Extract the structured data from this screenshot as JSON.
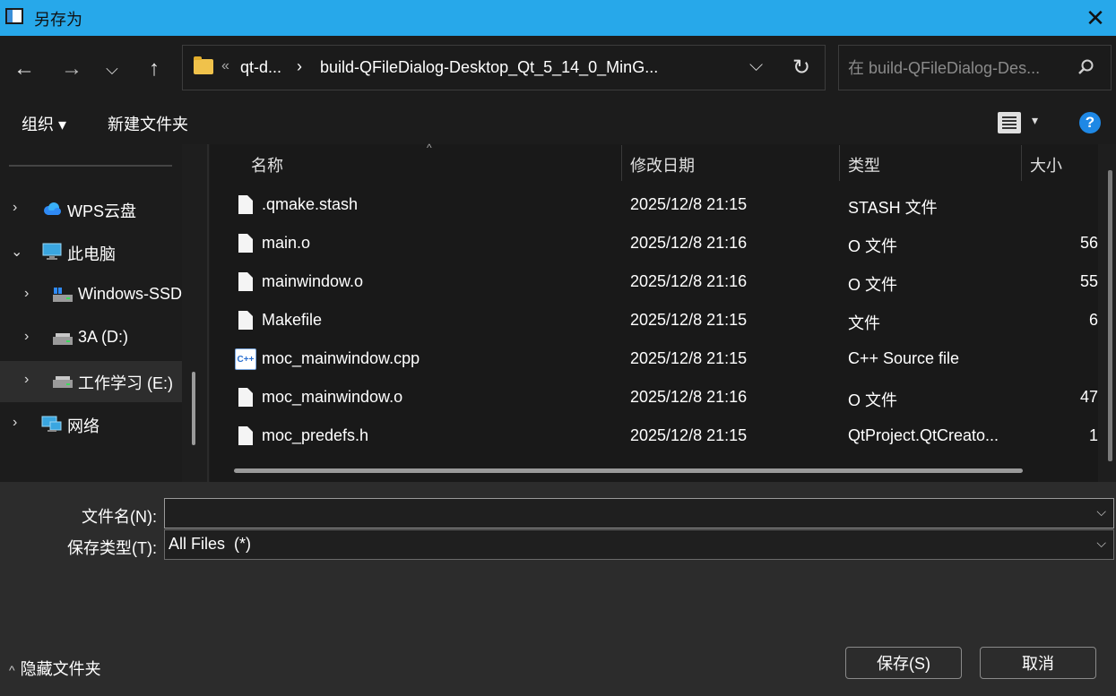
{
  "window": {
    "title": "另存为",
    "close_glyph": "✕"
  },
  "nav": {
    "back_glyph": "←",
    "forward_glyph": "→",
    "recent_glyph": "⌵",
    "up_glyph": "↑"
  },
  "address": {
    "overflow": "«",
    "segments": [
      "qt-d...",
      "build-QFileDialog-Desktop_Qt_5_14_0_MinG..."
    ],
    "separator": "›",
    "dropdown_glyph": "⌵",
    "refresh_glyph": "↻"
  },
  "search": {
    "placeholder": "在 build-QFileDialog-Des..."
  },
  "toolbar": {
    "organize": "组织 ▾",
    "new_folder": "新建文件夹",
    "view_dd": "▾",
    "help": "?"
  },
  "sidebar": {
    "items": [
      {
        "label": "WPS云盘",
        "chev": "›",
        "icon": "cloud-icon"
      },
      {
        "label": "此电脑",
        "chev": "⌄",
        "icon": "computer-icon"
      },
      {
        "label": "Windows-SSD",
        "chev": "›",
        "icon": "drive-icon"
      },
      {
        "label": "3A (D:)",
        "chev": "›",
        "icon": "drive-icon"
      },
      {
        "label": "工作学习 (E:)",
        "chev": "›",
        "icon": "drive-icon",
        "selected": true
      },
      {
        "label": "网络",
        "chev": "›",
        "icon": "network-icon"
      }
    ]
  },
  "columns": {
    "name": "名称",
    "modified": "修改日期",
    "type": "类型",
    "size": "大小",
    "sort_caret": "^"
  },
  "files": [
    {
      "name": ".qmake.stash",
      "modified": "2025/12/8 21:15",
      "type": "STASH 文件",
      "size": ""
    },
    {
      "name": "main.o",
      "modified": "2025/12/8 21:16",
      "type": "O 文件",
      "size": "56"
    },
    {
      "name": "mainwindow.o",
      "modified": "2025/12/8 21:16",
      "type": "O 文件",
      "size": "55"
    },
    {
      "name": "Makefile",
      "modified": "2025/12/8 21:15",
      "type": "文件",
      "size": "6"
    },
    {
      "name": "moc_mainwindow.cpp",
      "modified": "2025/12/8 21:15",
      "type": "C++ Source file",
      "size": ""
    },
    {
      "name": "moc_mainwindow.o",
      "modified": "2025/12/8 21:16",
      "type": "O 文件",
      "size": "47"
    },
    {
      "name": "moc_predefs.h",
      "modified": "2025/12/8 21:15",
      "type": "QtProject.QtCreato...",
      "size": "1"
    }
  ],
  "form": {
    "filename_label": "文件名(N):",
    "filename_value": "",
    "filetype_label": "保存类型(T):",
    "filetype_value": "All Files  (*)",
    "dropdown_glyph": "⌵"
  },
  "footer": {
    "hide_folders": "隐藏文件夹",
    "hide_glyph": "^",
    "save": "保存(S)",
    "cancel": "取消"
  },
  "colors": {
    "titlebar": "#27a8ea",
    "background": "#1e1e1e",
    "bottom": "#2c2c2c"
  }
}
